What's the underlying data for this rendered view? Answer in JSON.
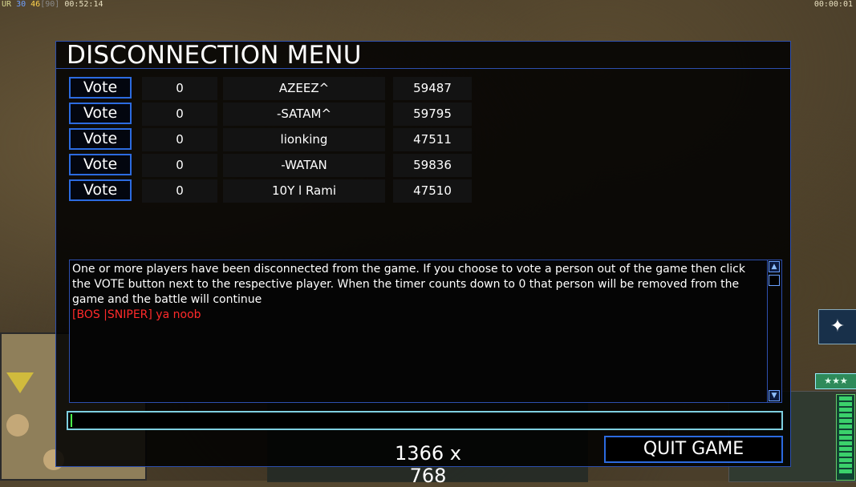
{
  "status": {
    "prefix": "UR",
    "stat_a": "30",
    "stat_b": "46",
    "stat_c": "[90]",
    "elapsed": "00:52:14",
    "right_timer": "00:00:01"
  },
  "hud": {
    "rank": "★★★"
  },
  "dialog": {
    "title": "DISCONNECTION MENU",
    "vote_label": "Vote",
    "players": [
      {
        "votes": "0",
        "name": "AZEEZ^",
        "id": "59487"
      },
      {
        "votes": "0",
        "name": "-SATAM^",
        "id": "59795"
      },
      {
        "votes": "0",
        "name": "lionking",
        "id": "47511"
      },
      {
        "votes": "0",
        "name": "-WATAN",
        "id": "59836"
      },
      {
        "votes": "0",
        "name": "10Y l Rami",
        "id": "47510"
      }
    ],
    "message": "One or more players have been disconnected from the game. If you choose to vote a person out of the game then click the VOTE button next to the respective player. When the timer counts down to 0 that person will be removed from the game and the battle will continue",
    "chat_line": "[BOS |SNIPER] ya noob",
    "chat_input_value": "",
    "resolution": "1366 x 768",
    "quit_label": "QUIT GAME"
  }
}
